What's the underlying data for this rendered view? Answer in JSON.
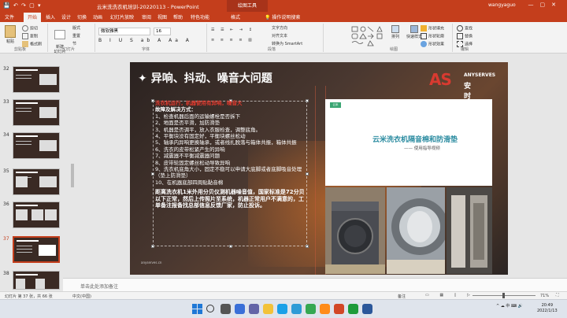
{
  "titlebar": {
    "quick_access": "💾 ↶ ↷ ▢ ▾",
    "title": "云米洗洗衣机培训-20220113  -  PowerPoint",
    "context_tab": "绘图工具",
    "user": "wangyaguo",
    "window_controls": "—▢✕"
  },
  "tabs": [
    {
      "label": "文件"
    },
    {
      "label": "开始"
    },
    {
      "label": "插入"
    },
    {
      "label": "设计"
    },
    {
      "label": "切换"
    },
    {
      "label": "动画"
    },
    {
      "label": "幻灯片放映"
    },
    {
      "label": "审阅"
    },
    {
      "label": "视图"
    },
    {
      "label": "帮助"
    },
    {
      "label": "特色功能"
    },
    {
      "label": "格式"
    }
  ],
  "tell_me": "操作说明搜索",
  "ribbon": {
    "paste": "粘贴",
    "cut": "剪切",
    "copy": "复制",
    "format_painter": "格式刷",
    "new_slide": "新建\n幻灯片",
    "layout": "版式",
    "reset": "重置",
    "section": "节",
    "font_name": "微软雅黑",
    "font_size": "16",
    "format_buttons": "B I U S ab A Aa A",
    "text_direction": "文字方向",
    "align_text": "对齐文本",
    "smartart": "转换为 SmartArt",
    "shape_fill": "形状填充",
    "shape_outline": "形状轮廓",
    "shape_effects": "形状效果",
    "arrange": "排列",
    "quick_styles": "快速样式",
    "find": "查找",
    "replace": "替换",
    "select": "选择",
    "groups": [
      "剪贴板",
      "幻灯片",
      "字体",
      "段落",
      "绘图",
      "编辑"
    ]
  },
  "thumbnails": [
    {
      "number": "32",
      "selected": false
    },
    {
      "number": "33",
      "selected": false
    },
    {
      "number": "34",
      "selected": false
    },
    {
      "number": "35",
      "selected": false
    },
    {
      "number": "36",
      "selected": false
    },
    {
      "number": "37",
      "selected": true
    },
    {
      "number": "38",
      "selected": false
    }
  ],
  "slide": {
    "title": "异响、抖动、噪音大问题",
    "logo_mark": "AS",
    "logo_en": "ANYSERVES",
    "logo_cn": "安时达",
    "red_line": "洗衣机运行，机器使用有异响，噪音大",
    "section_head": "故障及解决方式：",
    "items": [
      "1、检查机器后面的运输螺栓是否拆下",
      "2、地面是否平滑，加防滑垫",
      "3、机器是否调平，放入衣服检查，调整底角。",
      "4、平衡块没有固定好，平衡块螺丝松动",
      "5、轴承内异响更换轴承，或者线扎脱落与箱体共振，箱体共振",
      "6、洗衣的皮带松紧产生的异响",
      "7、减震器不平衡减震器问题",
      "8、皮带轮固定螺丝松动导致异响",
      "9、洗衣机底角大小，固定不稳可以申请大底脚或者底脚吸音处理（垫上防滑垫）",
      "10、在机器底部四周贴黏音棉"
    ],
    "conclusion": "距离洗衣机1米外用分贝仪测机器噪音值，国家标准是72分贝以下正常，然后上传照片至系统，机器正常用户不满意的，工单备注报备找总部信息反馈厂家，防止投诉。",
    "watermark": "anyserves.cn",
    "video_badge": "云米",
    "video_title": "云米洗衣机隔音棉和防滑垫",
    "video_subtitle": "—— 使用指导视频"
  },
  "notes_placeholder": "单击此处添加备注",
  "statusbar": {
    "slide_info": "幻灯片 第 37 张，共 66 张",
    "language": "中文(中国)",
    "notes": "备注",
    "zoom": "71%"
  },
  "taskbar": {
    "tray": "^ ☁ 中 ⌨ 🔊",
    "time": "20:49",
    "date": "2022/1/13"
  },
  "colors": {
    "accent": "#c43e1c",
    "slide_red": "#e23a2e",
    "video_teal": "#2a8ba0"
  }
}
